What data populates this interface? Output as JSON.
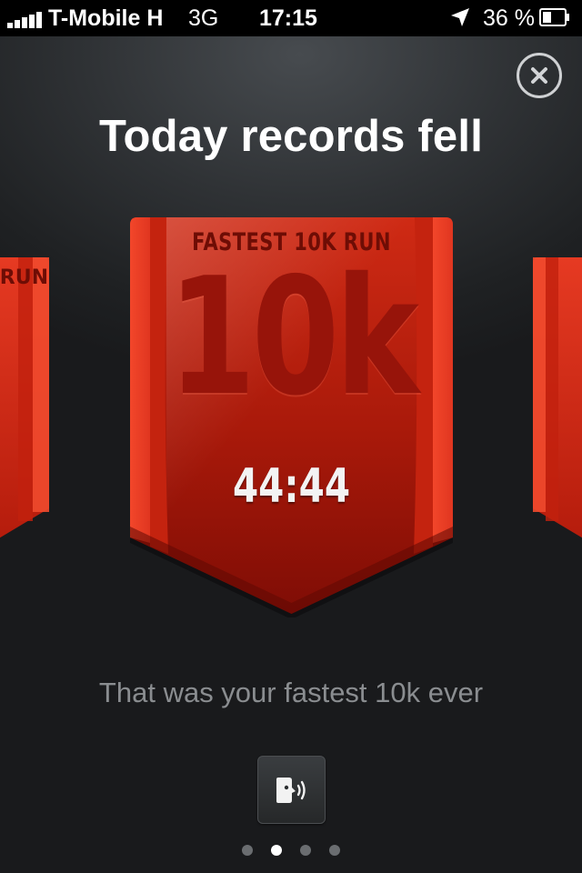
{
  "status_bar": {
    "carrier": "T-Mobile H",
    "network": "3G",
    "time": "17:15",
    "battery": "36 %",
    "icons": [
      "signal-icon",
      "location-arrow-icon",
      "battery-icon"
    ]
  },
  "close_icon": "close-icon",
  "title": "Today records fell",
  "badges": {
    "left": {
      "label": "RUN"
    },
    "main": {
      "label": "FASTEST 10K RUN",
      "big_text": "10k",
      "time": "44:44"
    },
    "right": {}
  },
  "message": "That was your fastest 10k ever",
  "voice_button_icon": "speaker-voice-icon",
  "pagination": {
    "count": 4,
    "active_index": 1
  },
  "colors": {
    "badge_red": "#e0331d",
    "badge_dark_red": "#8b1107",
    "background": "#2a2c2e",
    "accent_white": "#ffffff"
  }
}
